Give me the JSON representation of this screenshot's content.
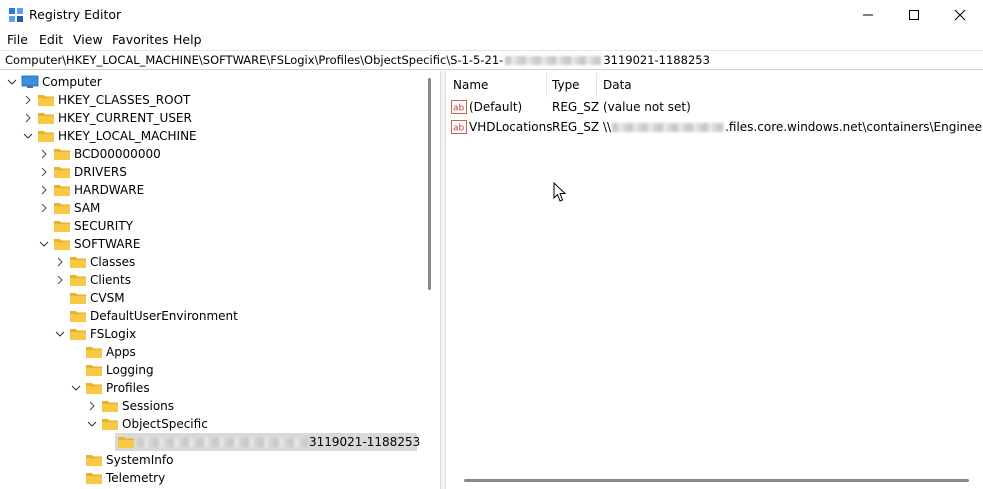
{
  "window": {
    "title": "Registry Editor"
  },
  "menu": [
    "File",
    "Edit",
    "View",
    "Favorites",
    "Help"
  ],
  "address": {
    "prefix": "Computer\\HKEY_LOCAL_MACHINE\\SOFTWARE\\FSLogix\\Profiles\\ObjectSpecific\\S-1-5-21-",
    "suffix": "3119021-1188253"
  },
  "tree": [
    {
      "label": "Computer",
      "level": 0,
      "state": "expanded",
      "icon": "computer-icon"
    },
    {
      "label": "HKEY_CLASSES_ROOT",
      "level": 1,
      "state": "collapsed",
      "icon": "folder-icon"
    },
    {
      "label": "HKEY_CURRENT_USER",
      "level": 1,
      "state": "collapsed",
      "icon": "folder-icon"
    },
    {
      "label": "HKEY_LOCAL_MACHINE",
      "level": 1,
      "state": "expanded",
      "icon": "folder-icon"
    },
    {
      "label": "BCD00000000",
      "level": 2,
      "state": "collapsed",
      "icon": "folder-icon"
    },
    {
      "label": "DRIVERS",
      "level": 2,
      "state": "collapsed",
      "icon": "folder-icon"
    },
    {
      "label": "HARDWARE",
      "level": 2,
      "state": "collapsed",
      "icon": "folder-icon"
    },
    {
      "label": "SAM",
      "level": 2,
      "state": "collapsed",
      "icon": "folder-icon"
    },
    {
      "label": "SECURITY",
      "level": 2,
      "state": "none",
      "icon": "folder-icon"
    },
    {
      "label": "SOFTWARE",
      "level": 2,
      "state": "expanded",
      "icon": "folder-icon"
    },
    {
      "label": "Classes",
      "level": 3,
      "state": "collapsed",
      "icon": "folder-icon"
    },
    {
      "label": "Clients",
      "level": 3,
      "state": "collapsed",
      "icon": "folder-icon"
    },
    {
      "label": "CVSM",
      "level": 3,
      "state": "none",
      "icon": "folder-icon"
    },
    {
      "label": "DefaultUserEnvironment",
      "level": 3,
      "state": "none",
      "icon": "folder-icon"
    },
    {
      "label": "FSLogix",
      "level": 3,
      "state": "expanded",
      "icon": "folder-icon"
    },
    {
      "label": "Apps",
      "level": 4,
      "state": "none",
      "icon": "folder-icon"
    },
    {
      "label": "Logging",
      "level": 4,
      "state": "none",
      "icon": "folder-icon"
    },
    {
      "label": "Profiles",
      "level": 4,
      "state": "expanded",
      "icon": "folder-icon"
    },
    {
      "label": "Sessions",
      "level": 5,
      "state": "collapsed",
      "icon": "folder-icon"
    },
    {
      "label": "ObjectSpecific",
      "level": 5,
      "state": "expanded",
      "icon": "folder-icon"
    },
    {
      "label": "3119021-1188253",
      "level": 6,
      "state": "none",
      "icon": "folder-icon",
      "selected": true,
      "redacted": true
    },
    {
      "label": "SystemInfo",
      "level": 4,
      "state": "none",
      "icon": "folder-icon"
    },
    {
      "label": "Telemetry",
      "level": 4,
      "state": "none",
      "icon": "folder-icon"
    }
  ],
  "list": {
    "columns": [
      "Name",
      "Type",
      "Data"
    ],
    "rows": [
      {
        "name": "(Default)",
        "type": "REG_SZ",
        "data_prefix": "(value not set)",
        "data_suffix": "",
        "redacted": false
      },
      {
        "name": "VHDLocations",
        "type": "REG_SZ",
        "data_prefix": "\\\\",
        "data_suffix": ".files.core.windows.net\\containers\\Engineering",
        "redacted": true
      }
    ]
  },
  "colors": {
    "folder": "#f8c945",
    "folder_dark": "#e8b12f",
    "selection": "#d9d9d9",
    "ab_icon": "#c0392b"
  }
}
